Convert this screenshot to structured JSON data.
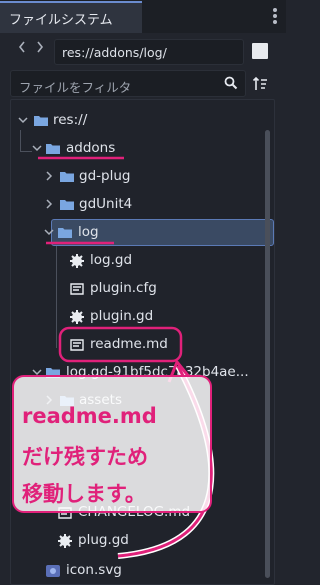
{
  "dock": {
    "tab_title": "ファイルシステム"
  },
  "path_bar": {
    "back_icon": "chevron-left-icon",
    "forward_icon": "chevron-right-icon",
    "path_value": "res://addons/log/"
  },
  "filter": {
    "placeholder": "ファイルをフィルタ"
  },
  "tree": {
    "items": [
      {
        "label": "res://",
        "icon": "folder-icon",
        "expanded": true
      },
      {
        "label": "addons",
        "icon": "folder-icon",
        "expanded": true
      },
      {
        "label": "gd-plug",
        "icon": "folder-icon",
        "expanded": false
      },
      {
        "label": "gdUnit4",
        "icon": "folder-icon",
        "expanded": false
      },
      {
        "label": "log",
        "icon": "folder-icon",
        "expanded": true,
        "selected": true
      },
      {
        "label": "log.gd",
        "icon": "gear-script-icon"
      },
      {
        "label": "plugin.cfg",
        "icon": "text-file-icon"
      },
      {
        "label": "plugin.gd",
        "icon": "gear-script-icon"
      },
      {
        "label": "readme.md",
        "icon": "text-file-icon"
      },
      {
        "label": "log.gd-91bf5dc7a32b4ae...",
        "icon": "folder-icon",
        "expanded": true
      },
      {
        "label": "assets",
        "icon": "folder-icon",
        "expanded": false
      },
      {
        "label": "CHANGELOG.md",
        "icon": "text-file-icon"
      },
      {
        "label": "plug.gd",
        "icon": "gear-script-icon"
      },
      {
        "label": "icon.svg",
        "icon": "image-file-icon"
      }
    ]
  },
  "annotation": {
    "lines": [
      "readme.md",
      "だけ残すため",
      "移動します。"
    ],
    "accent_color": "#e0217a"
  },
  "colors": {
    "folder": "#7aa6e0",
    "selection": "#3a4a63",
    "selection_border": "#5b7ab6",
    "background": "#20232b"
  }
}
